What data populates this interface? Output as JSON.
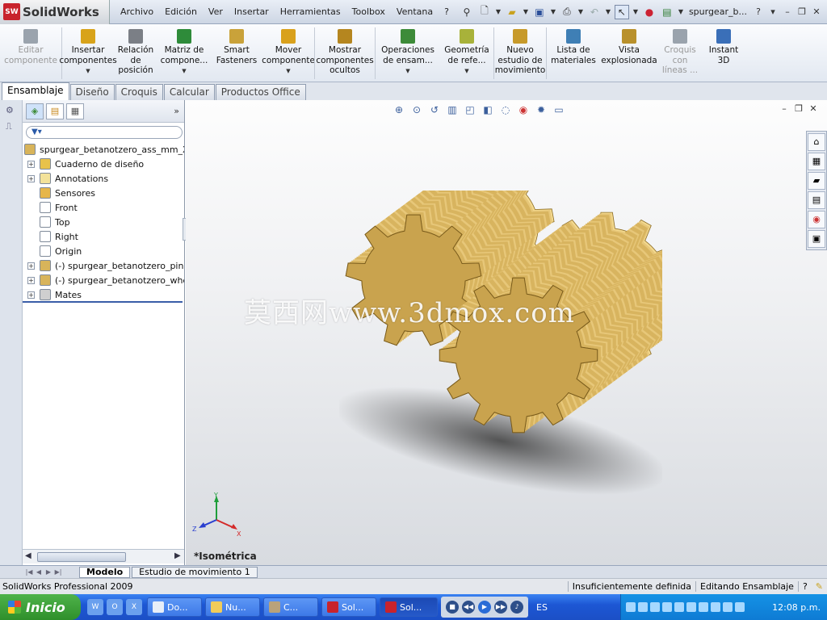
{
  "app": {
    "brand": "SolidWorks",
    "logo_text": "SW"
  },
  "menu": [
    "Archivo",
    "Edición",
    "Ver",
    "Insertar",
    "Herramientas",
    "Toolbox",
    "Ventana",
    "?"
  ],
  "doc_title": "spurgear_b...",
  "title_help": "?",
  "ribbon": [
    {
      "label": "Editar\ncomponente",
      "icon": "edit-component-icon",
      "disabled": true,
      "dropdown": false,
      "color": "#9aa3ad"
    },
    {
      "label": "Insertar\ncomponentes",
      "icon": "insert-components-icon",
      "disabled": false,
      "dropdown": true,
      "color": "#d8a31a"
    },
    {
      "label": "Relación\nde\nposición",
      "icon": "mate-icon",
      "disabled": false,
      "dropdown": false,
      "color": "#7b7f86"
    },
    {
      "label": "Matriz de\ncompone...",
      "icon": "pattern-icon",
      "disabled": false,
      "dropdown": true,
      "color": "#2e8b3a"
    },
    {
      "label": "Smart\nFasteners",
      "icon": "smart-fasteners-icon",
      "disabled": false,
      "dropdown": false,
      "color": "#c9a23a"
    },
    {
      "label": "Mover\ncomponente",
      "icon": "move-component-icon",
      "disabled": false,
      "dropdown": true,
      "color": "#d9a11c"
    },
    {
      "label": "Mostrar\ncomponentes\nocultos",
      "icon": "show-hidden-icon",
      "disabled": false,
      "dropdown": false,
      "color": "#b5861f"
    },
    {
      "label": "Operaciones\nde ensam...",
      "icon": "assembly-features-icon",
      "disabled": false,
      "dropdown": true,
      "color": "#3d8b39"
    },
    {
      "label": "Geometría\nde refe...",
      "icon": "reference-geometry-icon",
      "disabled": false,
      "dropdown": true,
      "color": "#a8b23a"
    },
    {
      "label": "Nuevo\nestudio de\nmovimiento",
      "icon": "motion-study-icon",
      "disabled": false,
      "dropdown": false,
      "color": "#c79a2a"
    },
    {
      "label": "Lista de\nmateriales",
      "icon": "bom-icon",
      "disabled": false,
      "dropdown": false,
      "color": "#3f7fb5"
    },
    {
      "label": "Vista\nexplosionada",
      "icon": "exploded-view-icon",
      "disabled": false,
      "dropdown": false,
      "color": "#b9912c"
    },
    {
      "label": "Croquis\ncon\nlíneas ...",
      "icon": "explode-line-sketch-icon",
      "disabled": true,
      "dropdown": false,
      "color": "#9aa3ad"
    },
    {
      "label": "Instant\n3D",
      "icon": "instant-3d-icon",
      "disabled": false,
      "dropdown": false,
      "color": "#3a6fb8"
    }
  ],
  "tabs": [
    "Ensamblaje",
    "Diseño",
    "Croquis",
    "Calcular",
    "Productos Office"
  ],
  "active_tab": 0,
  "tree": {
    "root": "spurgear_betanotzero_ass_mm_XEL",
    "items": [
      {
        "label": "Cuaderno de diseño",
        "icon": "design-binder-icon",
        "expandable": true
      },
      {
        "label": "Annotations",
        "icon": "annotations-icon",
        "expandable": true
      },
      {
        "label": "Sensores",
        "icon": "sensors-icon",
        "expandable": false
      },
      {
        "label": "Front",
        "icon": "plane-icon",
        "expandable": false
      },
      {
        "label": "Top",
        "icon": "plane-icon",
        "expandable": false
      },
      {
        "label": "Right",
        "icon": "plane-icon",
        "expandable": false
      },
      {
        "label": "Origin",
        "icon": "origin-icon",
        "expandable": false
      },
      {
        "label": "(-) spurgear_betanotzero_pinion",
        "icon": "part-icon",
        "expandable": true
      },
      {
        "label": "(-) spurgear_betanotzero_wheel",
        "icon": "part-icon",
        "expandable": true
      },
      {
        "label": "Mates",
        "icon": "mates-icon",
        "expandable": true
      }
    ]
  },
  "viewport": {
    "view_name": "*Isométrica",
    "watermark": "莫西网www.3dmox.com",
    "triad": {
      "x": "X",
      "y": "Y",
      "z": "Z"
    },
    "gear_color": "#c9a34e"
  },
  "bottom_tabs": [
    "Modelo",
    "Estudio de movimiento 1"
  ],
  "status": {
    "left": "SolidWorks Professional 2009",
    "right": [
      "Insuficientemente definida",
      "Editando Ensamblaje",
      "?"
    ]
  },
  "taskbar": {
    "start": "Inicio",
    "tasks": [
      "Do...",
      "Nu...",
      "C...",
      "Sol...",
      "Sol..."
    ],
    "active_task": 4,
    "lang": "ES",
    "clock": "12:08 p.m."
  }
}
